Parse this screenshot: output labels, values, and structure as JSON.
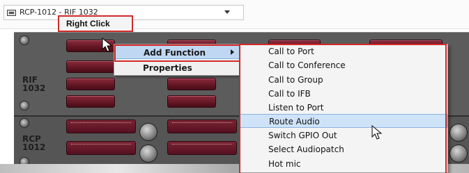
{
  "toolbar": {
    "device_selector_value": "RCP-1012 - RIF 1032",
    "icons": [
      "device-icon",
      "dropdown-caret-icon"
    ]
  },
  "callout": {
    "label": "Right Click"
  },
  "panels": {
    "top": {
      "model": "RIF\n1032"
    },
    "bottom": {
      "model": "RCP\n1012"
    }
  },
  "context_menu": {
    "items": [
      {
        "label": "Add Function",
        "has_submenu": true,
        "highlighted": true
      },
      {
        "label": "Properties",
        "has_submenu": false,
        "highlighted": false
      }
    ]
  },
  "add_function_submenu": {
    "items": [
      {
        "label": "Call to Port"
      },
      {
        "label": "Call to Conference"
      },
      {
        "label": "Call to Group"
      },
      {
        "label": "Call to IFB"
      },
      {
        "label": "Listen to Port"
      },
      {
        "label": "Route Audio",
        "selected": true
      },
      {
        "label": "Switch GPIO Out"
      },
      {
        "label": "Select Audiopatch"
      },
      {
        "label": "Hot mic"
      }
    ]
  },
  "colors": {
    "highlight_outline": "#d32a2a",
    "menu_selection": "#cfe3f8",
    "panel_key": "#5c1220"
  }
}
